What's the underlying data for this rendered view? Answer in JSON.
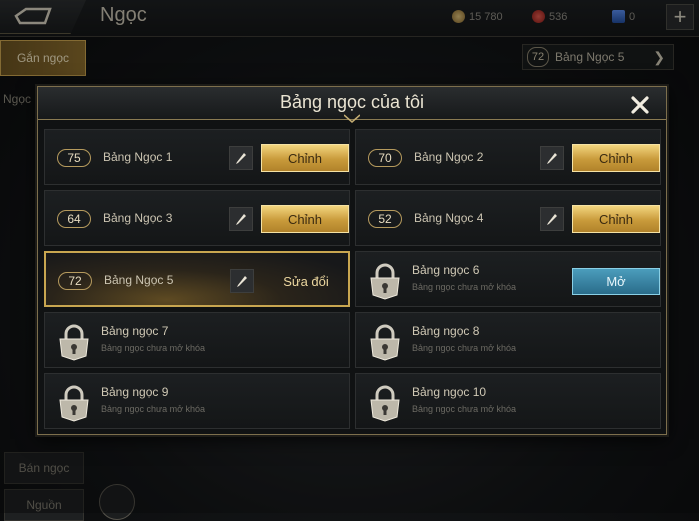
{
  "header": {
    "title": "Ngọc",
    "resources": [
      {
        "icon": "gold-coin-icon",
        "value": "15 780",
        "color": "#c9a45a"
      },
      {
        "icon": "red-gem-icon",
        "value": "536",
        "color": "#c0302a"
      },
      {
        "icon": "blue-voucher-icon",
        "value": "0",
        "color": "#3a6ed0"
      }
    ],
    "plus_label": "+"
  },
  "sidebar": {
    "active_tab": "Gắn ngọc",
    "behind_label": "Ngọc",
    "bottom_tabs": [
      "Bán ngọc",
      "Nguồn"
    ]
  },
  "page_selector": {
    "level": "72",
    "name": "Bảng Ngọc 5"
  },
  "modal": {
    "title": "Bảng ngọc của tôi",
    "slots": [
      {
        "level": "75",
        "name": "Bảng Ngọc 1",
        "state": "unlocked",
        "action": "Chỉnh"
      },
      {
        "level": "70",
        "name": "Bảng Ngọc 2",
        "state": "unlocked",
        "action": "Chỉnh"
      },
      {
        "level": "64",
        "name": "Bảng Ngọc 3",
        "state": "unlocked",
        "action": "Chỉnh"
      },
      {
        "level": "52",
        "name": "Bảng Ngọc 4",
        "state": "unlocked",
        "action": "Chỉnh"
      },
      {
        "level": "72",
        "name": "Bảng Ngọc 5",
        "state": "selected",
        "action": "Sửa đổi"
      },
      {
        "name": "Bảng ngọc 6",
        "state": "locked",
        "sub": "Bảng ngọc chưa mở khóa",
        "action": "Mở"
      },
      {
        "name": "Bảng ngọc 7",
        "state": "locked",
        "sub": "Bảng ngọc chưa mở khóa"
      },
      {
        "name": "Bảng ngọc 8",
        "state": "locked",
        "sub": "Bảng ngọc chưa mở khóa"
      },
      {
        "name": "Bảng ngọc 9",
        "state": "locked",
        "sub": "Bảng ngọc chưa mở khóa"
      },
      {
        "name": "Bảng ngọc 10",
        "state": "locked",
        "sub": "Bảng ngọc chưa mở khóa"
      }
    ]
  }
}
